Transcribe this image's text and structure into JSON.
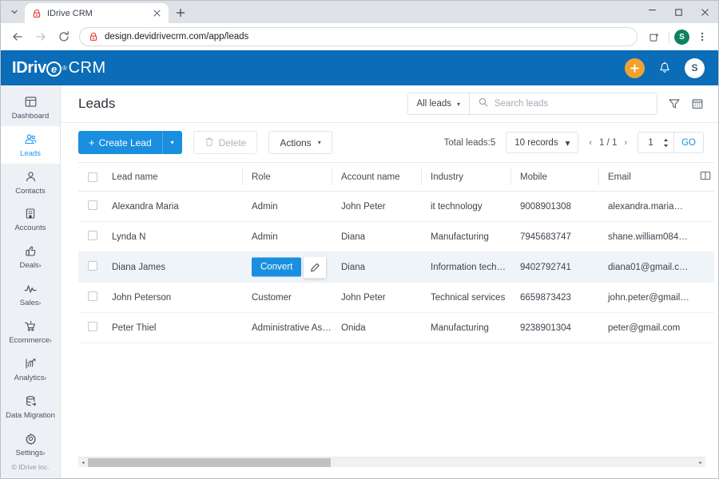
{
  "browser": {
    "tab_list_icon": "chevron-down-icon",
    "tab": {
      "favicon": "idrive-lock-icon",
      "title": "IDrive CRM",
      "close_icon": "close-icon"
    },
    "new_tab_icon": "plus-icon",
    "window_controls": {
      "minimize": "minimize-icon",
      "maximize": "maximize-icon",
      "close": "close-icon"
    },
    "nav": {
      "back_icon": "back-arrow-icon",
      "forward_icon": "forward-arrow-icon",
      "reload_icon": "reload-icon"
    },
    "omnibox": {
      "site_icon": "idrive-lock-icon",
      "url": "design.devidrivecrm.com/app/leads"
    },
    "toolbar_right": {
      "share_icon": "share-save-icon",
      "profile_initial": "S",
      "menu_icon": "three-dots-icon"
    }
  },
  "app_header": {
    "brand": {
      "part1": "IDriv",
      "emark": "e",
      "reg": "®",
      "crm": "CRM"
    },
    "add_icon": "plus-icon",
    "notifications_icon": "bell-icon",
    "avatar_initial": "S"
  },
  "sidebar": {
    "items": [
      {
        "label": "Dashboard",
        "icon": "dashboard-icon",
        "caret": "",
        "active": false
      },
      {
        "label": "Leads",
        "icon": "leads-icon",
        "caret": "",
        "active": true
      },
      {
        "label": "Contacts",
        "icon": "contacts-icon",
        "caret": "",
        "active": false
      },
      {
        "label": "Accounts",
        "icon": "accounts-icon",
        "caret": "",
        "active": false
      },
      {
        "label": "Deals",
        "icon": "deals-thumbsup-icon",
        "caret": "›",
        "active": false
      },
      {
        "label": "Sales",
        "icon": "sales-pulse-icon",
        "caret": "›",
        "active": false
      },
      {
        "label": "Ecommerce",
        "icon": "ecommerce-cart-icon",
        "caret": "›",
        "active": false
      },
      {
        "label": "Analytics",
        "icon": "analytics-chart-icon",
        "caret": "›",
        "active": false
      },
      {
        "label": "Data Migration",
        "icon": "data-migration-icon",
        "caret": "",
        "active": false
      },
      {
        "label": "Settings",
        "icon": "gear-icon",
        "caret": "›",
        "active": false
      }
    ],
    "footer": "© IDrive Inc."
  },
  "page": {
    "title": "Leads",
    "view_filter": {
      "label": "All leads",
      "caret": "▾"
    },
    "search": {
      "placeholder": "Search leads",
      "value": "",
      "icon": "search-icon"
    },
    "filter_icon": "funnel-filter-icon",
    "calendar_icon": "calendar-icon"
  },
  "toolbar": {
    "create_label": "Create Lead",
    "create_plus": "+",
    "create_caret": "▾",
    "delete_label": "Delete",
    "delete_icon": "trash-icon",
    "actions_label": "Actions",
    "actions_caret": "▾",
    "total_label": "Total leads:",
    "total_value": "5",
    "records_label": "10 records",
    "records_caret": "▾",
    "prev_icon": "‹",
    "page_indicator": "1 / 1",
    "next_icon": "›",
    "goto_value": "1",
    "go_label": "GO"
  },
  "table": {
    "columns": [
      "Lead name",
      "Role",
      "Account name",
      "Industry",
      "Mobile",
      "Email"
    ],
    "column_settings_icon": "column-chooser-icon",
    "rows": [
      {
        "lead_name": "Alexandra Maria",
        "role": "Admin",
        "account_name": "John Peter",
        "industry": "it technology",
        "mobile": "9008901308",
        "email": "alexandra.maria@g...",
        "hovered": false
      },
      {
        "lead_name": "Lynda N",
        "role": "Admin",
        "account_name": "Diana",
        "industry": "Manufacturing",
        "mobile": "7945683747",
        "email": "shane.william084+e...",
        "hovered": false
      },
      {
        "lead_name": "Diana James",
        "role": "",
        "account_name": "Diana",
        "industry": "Information technol...",
        "mobile": "9402792741",
        "email": "diana01@gmail.com",
        "hovered": true
      },
      {
        "lead_name": "John Peterson",
        "role": "Customer",
        "account_name": "John Peter",
        "industry": "Technical services",
        "mobile": "6659873423",
        "email": "john.peter@gmail.co...",
        "hovered": false
      },
      {
        "lead_name": "Peter Thiel",
        "role": "Administrative Assist...",
        "account_name": "Onida",
        "industry": "Manufacturing",
        "mobile": "9238901304",
        "email": "peter@gmail.com",
        "hovered": false
      }
    ],
    "row_actions": {
      "convert_label": "Convert",
      "edit_icon": "pencil-edit-icon"
    }
  },
  "scrollbar": {
    "left_arrow": "◂",
    "right_arrow": "▸",
    "thumb_percent": 40
  },
  "colors": {
    "brand_blue": "#0b6cb8",
    "accent_blue": "#1a8fe0",
    "active_blue": "#2196f3",
    "orange": "#f0a22e",
    "sidebar_bg": "#edf1f5",
    "row_hover": "#eff4f9"
  }
}
